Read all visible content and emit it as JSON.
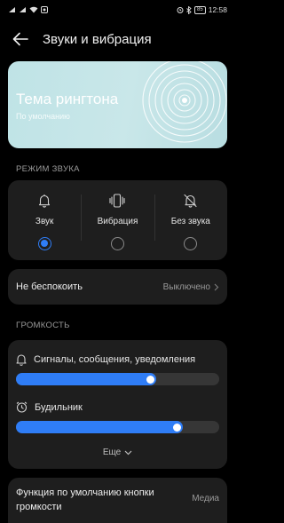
{
  "status_bar": {
    "battery": "85",
    "time": "12:58"
  },
  "header": {
    "title": "Звуки и вибрация"
  },
  "ringtone_theme": {
    "title": "Тема рингтона",
    "subtitle": "По умолчанию"
  },
  "sound_mode": {
    "section_label": "РЕЖИМ ЗВУКА",
    "options": [
      {
        "label": "Звук",
        "icon": "bell-icon",
        "selected": true
      },
      {
        "label": "Вибрация",
        "icon": "vibration-icon",
        "selected": false
      },
      {
        "label": "Без звука",
        "icon": "bell-off-icon",
        "selected": false
      }
    ]
  },
  "do_not_disturb": {
    "label": "Не беспокоить",
    "value": "Выключено"
  },
  "volume": {
    "section_label": "ГРОМКОСТЬ",
    "sliders": [
      {
        "label": "Сигналы, сообщения, уведомления",
        "icon": "bell-icon",
        "level": 0.69
      },
      {
        "label": "Будильник",
        "icon": "alarm-clock-icon",
        "level": 0.82
      }
    ],
    "more_label": "Еще"
  },
  "volume_button_function": {
    "label": "Функция по умолчанию кнопки громкости",
    "value": "Медиа"
  },
  "colors": {
    "accent": "#2f7df6",
    "card_background": "#1e1e1e",
    "page_background": "#000000"
  }
}
